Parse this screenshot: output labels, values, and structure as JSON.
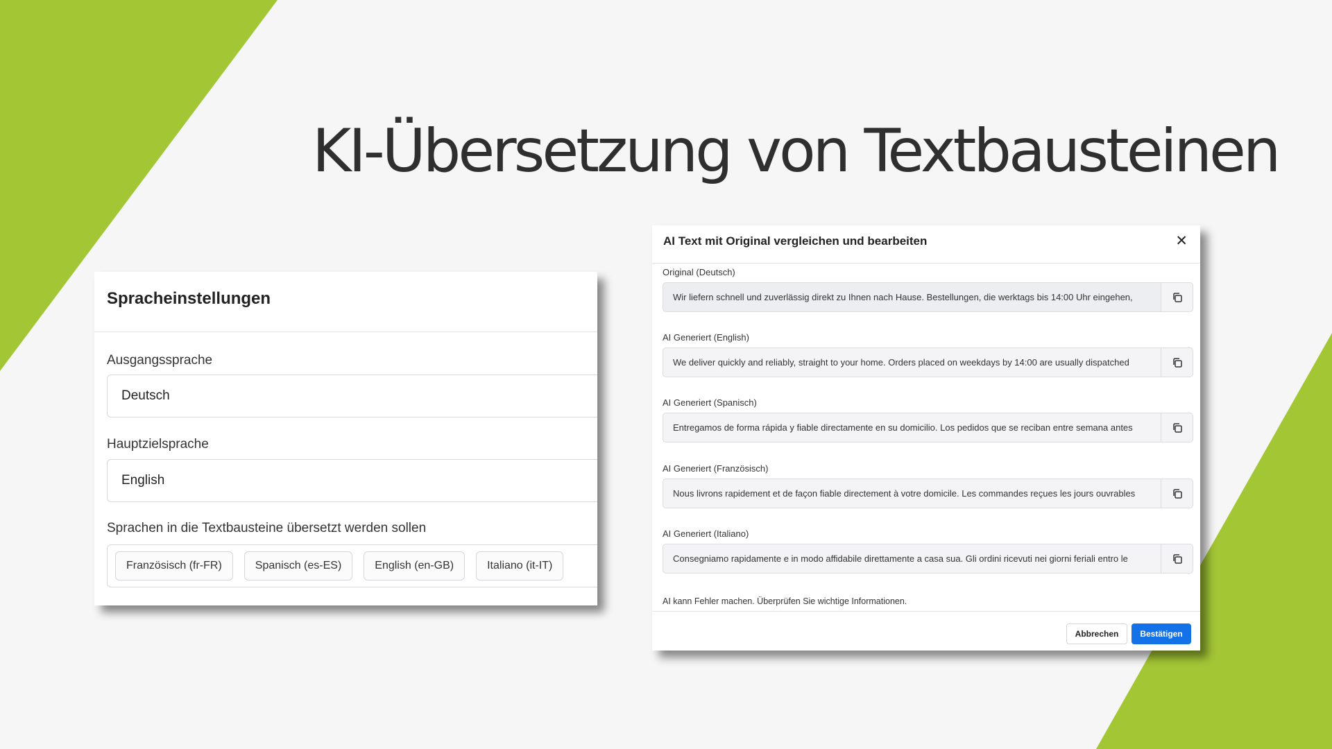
{
  "slide": {
    "title": "KI-Übersetzung von Textbausteinen",
    "accent_color": "#a3c635"
  },
  "language_settings": {
    "title": "Spracheinstellungen",
    "source_label": "Ausgangssprache",
    "source_value": "Deutsch",
    "target_label": "Hauptzielsprache",
    "target_value": "English",
    "languages_label": "Sprachen in die Textbausteine übersetzt werden sollen",
    "languages": [
      "Französisch (fr-FR)",
      "Spanisch (es-ES)",
      "English (en-GB)",
      "Italiano (it-IT)"
    ]
  },
  "dialog": {
    "title": "AI Text mit Original vergleichen und bearbeiten",
    "close_icon": "close-icon",
    "rows": [
      {
        "label": "Original (Deutsch)",
        "text": "Wir liefern schnell und zuverlässig direkt zu Ihnen nach Hause. Bestellungen, die werktags bis 14:00 Uhr eingehen,"
      },
      {
        "label": "AI Generiert (English)",
        "text": "We deliver quickly and reliably, straight to your home. Orders placed on weekdays by 14:00 are usually dispatched"
      },
      {
        "label": "AI Generiert (Spanisch)",
        "text": "Entregamos de forma rápida y fiable directamente en su domicilio. Los pedidos que se reciban entre semana antes"
      },
      {
        "label": "AI Generiert (Französisch)",
        "text": "Nous livrons rapidement et de façon fiable directement à votre domicile. Les commandes reçues les jours ouvrables"
      },
      {
        "label": "AI Generiert (Italiano)",
        "text": "Consegniamo rapidamente e in modo affidabile direttamente a casa sua. Gli ordini ricevuti nei giorni feriali entro le"
      }
    ],
    "copy_icon": "copy-icon",
    "disclaimer": "AI kann Fehler machen. Überprüfen Sie wichtige Informationen.",
    "cancel_label": "Abbrechen",
    "confirm_label": "Bestätigen",
    "confirm_color": "#1472e8"
  }
}
